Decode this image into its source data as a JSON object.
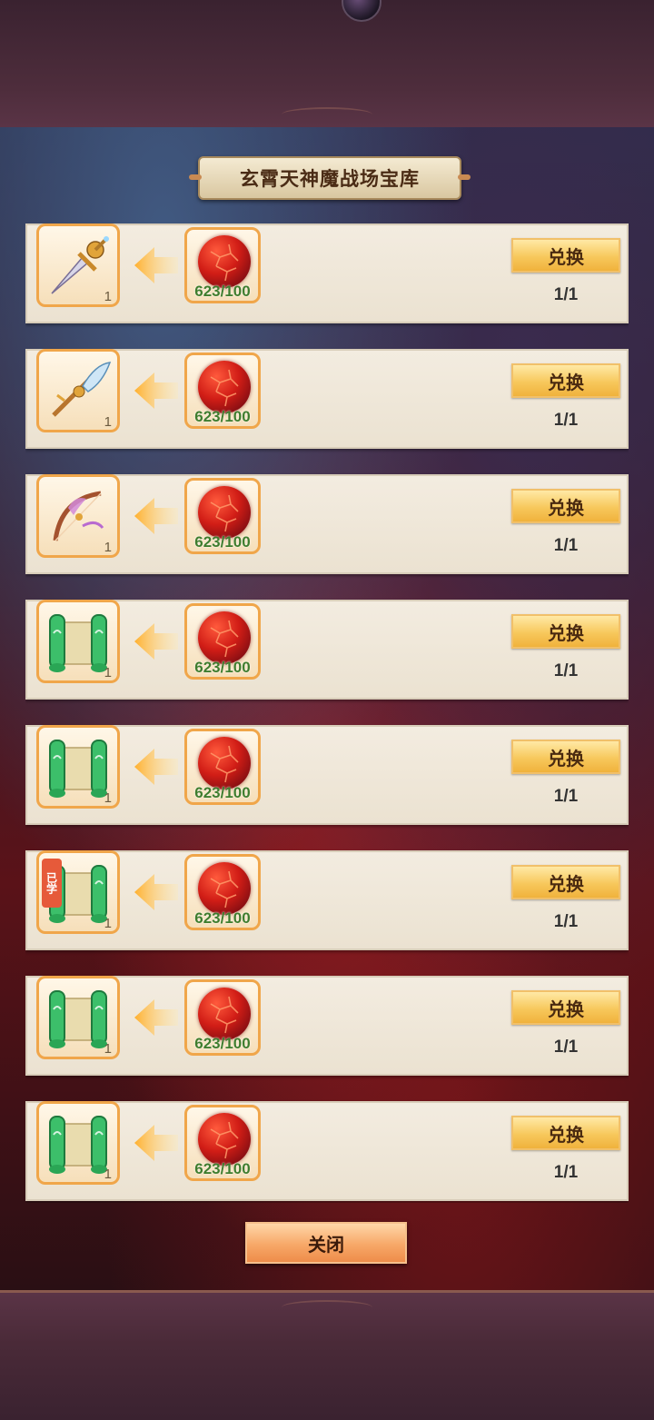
{
  "title": "玄霄天神魔战场宝库",
  "close_label": "关闭",
  "exchange_label": "兑换",
  "colors": {
    "button_gold": "#f7c85c",
    "cost_green": "#3f7d2e",
    "slot_border": "#f0a64a",
    "learned_tag": "#e65a3a"
  },
  "rows": [
    {
      "reward": "sword-icon",
      "reward_count": "1",
      "cost_icon": "red-orb-icon",
      "cost_count": "623/100",
      "limit": "1/1",
      "learned": ""
    },
    {
      "reward": "glaive-icon",
      "reward_count": "1",
      "cost_icon": "red-orb-icon",
      "cost_count": "623/100",
      "limit": "1/1",
      "learned": ""
    },
    {
      "reward": "bow-icon",
      "reward_count": "1",
      "cost_icon": "red-orb-icon",
      "cost_count": "623/100",
      "limit": "1/1",
      "learned": ""
    },
    {
      "reward": "scroll-icon",
      "reward_count": "1",
      "cost_icon": "red-orb-icon",
      "cost_count": "623/100",
      "limit": "1/1",
      "learned": ""
    },
    {
      "reward": "scroll-icon",
      "reward_count": "1",
      "cost_icon": "red-orb-icon",
      "cost_count": "623/100",
      "limit": "1/1",
      "learned": ""
    },
    {
      "reward": "scroll-icon",
      "reward_count": "1",
      "cost_icon": "red-orb-icon",
      "cost_count": "623/100",
      "limit": "1/1",
      "learned": "已学"
    },
    {
      "reward": "scroll-icon",
      "reward_count": "1",
      "cost_icon": "red-orb-icon",
      "cost_count": "623/100",
      "limit": "1/1",
      "learned": ""
    },
    {
      "reward": "scroll-icon",
      "reward_count": "1",
      "cost_icon": "red-orb-icon",
      "cost_count": "623/100",
      "limit": "1/1",
      "learned": ""
    }
  ]
}
